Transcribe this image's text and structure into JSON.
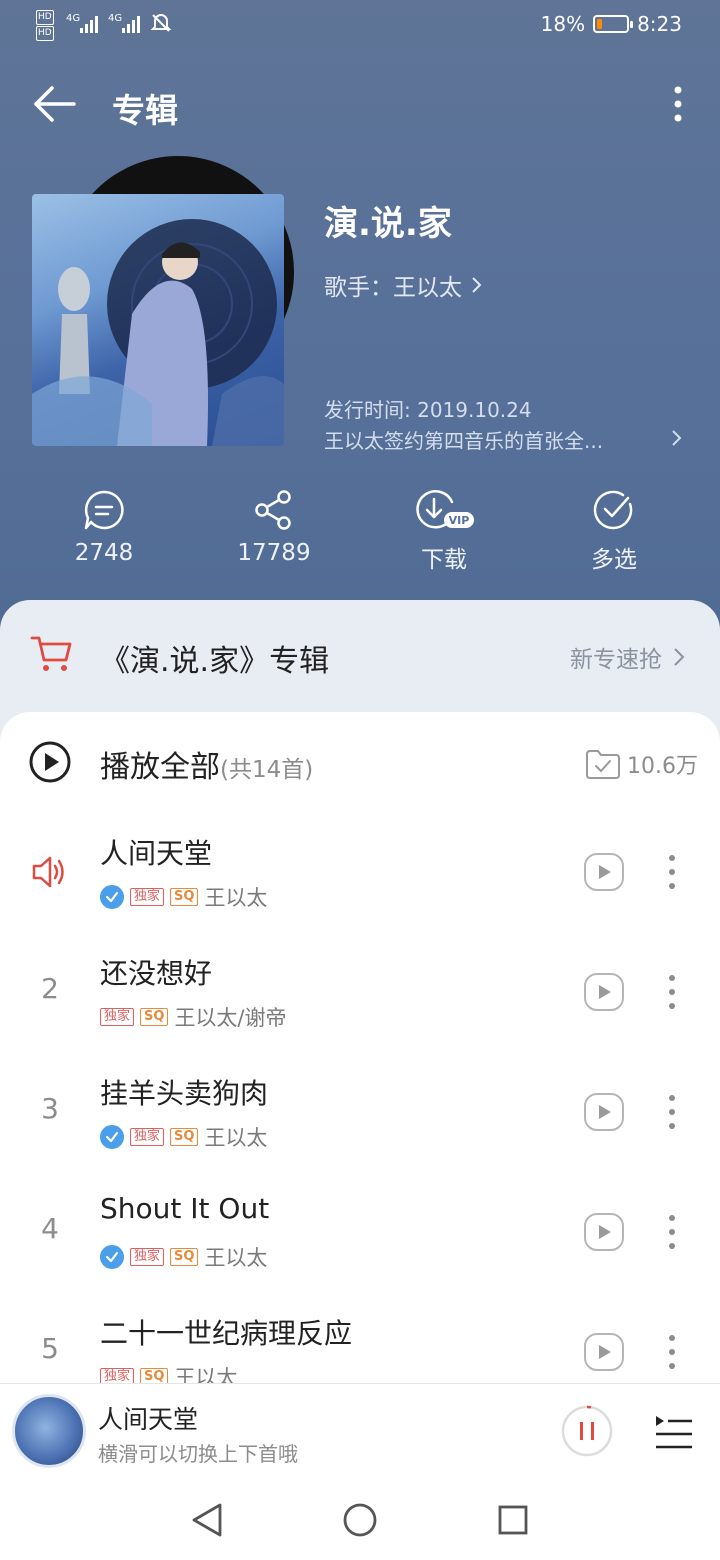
{
  "status_bar": {
    "hd1": "HD",
    "hd2": "HD",
    "net1": "4G",
    "net2": "4G",
    "battery_percent": "18%",
    "battery_level": 0.18,
    "time": "8:23"
  },
  "header": {
    "title": "专辑"
  },
  "album": {
    "name": "演.说.家",
    "artist_prefix": "歌手：",
    "artist": "王以太",
    "release": "发行时间: 2019.10.24",
    "description": "王以太签约第四音乐的首张全..."
  },
  "actions": [
    {
      "label": "2748",
      "icon": "comment-icon"
    },
    {
      "label": "17789",
      "icon": "share-icon"
    },
    {
      "label": "下载",
      "icon": "download-vip-icon"
    },
    {
      "label": "多选",
      "icon": "multi-select-icon"
    }
  ],
  "shop": {
    "title": "《演.说.家》专辑",
    "action": "新专速抢"
  },
  "playall": {
    "label": "播放全部",
    "count": "(共14首)",
    "fav_count": "10.6万"
  },
  "songs": [
    {
      "index": "",
      "playing": true,
      "name": "人间天堂",
      "verified": true,
      "exclusive": "独家",
      "quality": "SQ",
      "artist": "王以太"
    },
    {
      "index": "2",
      "playing": false,
      "name": "还没想好",
      "verified": false,
      "exclusive": "独家",
      "quality": "SQ",
      "artist": "王以太/谢帝"
    },
    {
      "index": "3",
      "playing": false,
      "name": "挂羊头卖狗肉",
      "verified": true,
      "exclusive": "独家",
      "quality": "SQ",
      "artist": "王以太"
    },
    {
      "index": "4",
      "playing": false,
      "name": "Shout It Out",
      "verified": true,
      "exclusive": "独家",
      "quality": "SQ",
      "artist": "王以太"
    },
    {
      "index": "5",
      "playing": false,
      "name": "二十一世纪病理反应",
      "verified": false,
      "exclusive": "独家",
      "quality": "SQ",
      "artist": "王以太"
    }
  ],
  "mini_player": {
    "title": "人间天堂",
    "subtitle": "横滑可以切换上下首哦"
  },
  "colors": {
    "header_bg": "#5a7299",
    "accent_red": "#e04a3f",
    "verified_blue": "#4a9eea"
  }
}
